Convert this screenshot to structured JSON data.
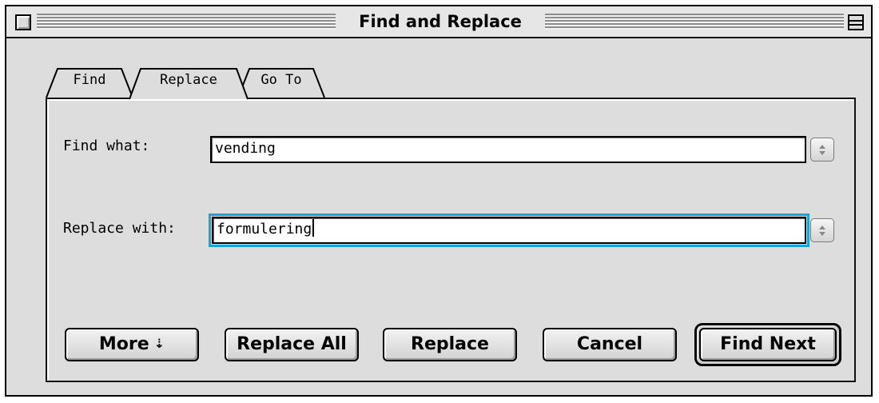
{
  "window": {
    "title": "Find and Replace"
  },
  "tabs": [
    {
      "label": "Find"
    },
    {
      "label": "Replace"
    },
    {
      "label": "Go To"
    }
  ],
  "find": {
    "label": "Find what:",
    "value": "vending"
  },
  "replace": {
    "label": "Replace with:",
    "value": "formulering"
  },
  "buttons": {
    "more": "More",
    "more_glyph": "⇣",
    "replace_all": "Replace All",
    "replace": "Replace",
    "cancel": "Cancel",
    "find_next": "Find Next"
  },
  "colors": {
    "focus_ring": "#1aa3d9",
    "window_bg": "#dddddd"
  }
}
